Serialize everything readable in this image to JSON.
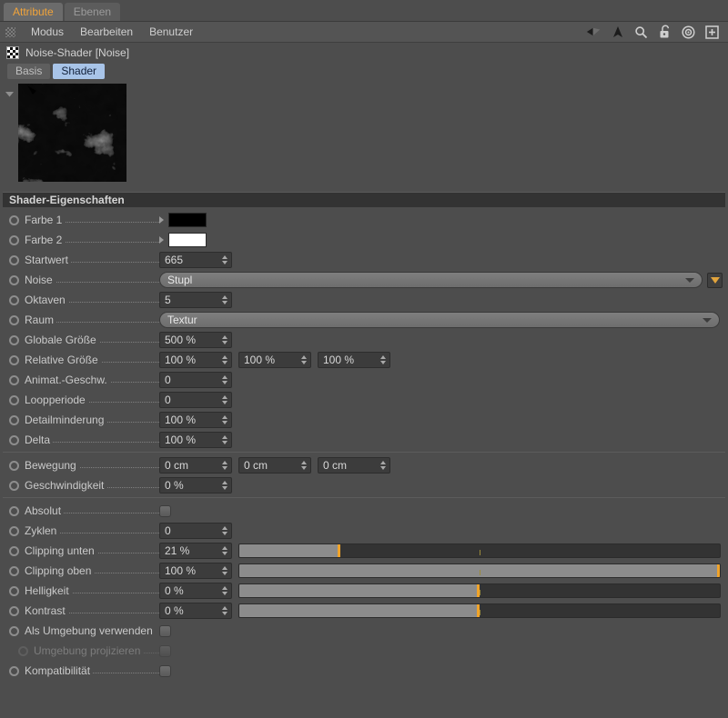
{
  "window": {
    "tabs": [
      {
        "label": "Attribute",
        "active": true
      },
      {
        "label": "Ebenen",
        "active": false
      }
    ]
  },
  "menubar": {
    "grip_icon": "grip-dots-icon",
    "items": [
      "Modus",
      "Bearbeiten",
      "Benutzer"
    ],
    "icons": [
      "back-arrow-icon",
      "up-arrow-icon",
      "search-icon",
      "lock-open-icon",
      "target-icon",
      "plus-box-icon"
    ]
  },
  "object": {
    "icon": "checker-shader-icon",
    "name": "Noise-Shader [Noise]"
  },
  "subtabs": [
    {
      "label": "Basis",
      "active": false
    },
    {
      "label": "Shader",
      "active": true
    }
  ],
  "preview": {
    "collapse_icon": "triangle-down-icon",
    "alt": "noise-preview-thumbnail"
  },
  "group": {
    "title": "Shader-Eigenschaften"
  },
  "rows": [
    {
      "label": "Farbe 1",
      "type": "color",
      "color": "#000000",
      "arrow": true
    },
    {
      "label": "Farbe 2",
      "type": "color",
      "color": "#ffffff",
      "arrow": true
    },
    {
      "label": "Startwert",
      "type": "number",
      "fields": [
        "665"
      ]
    },
    {
      "label": "Noise",
      "type": "combo",
      "value": "Stupl",
      "filter": true
    },
    {
      "label": "Oktaven",
      "type": "number",
      "fields": [
        "5"
      ]
    },
    {
      "label": "Raum",
      "type": "combo",
      "value": "Textur",
      "filter": false
    },
    {
      "label": "Globale Größe",
      "type": "number",
      "fields": [
        "500 %"
      ]
    },
    {
      "label": "Relative Größe",
      "type": "number",
      "fields": [
        "100 %",
        "100 %",
        "100 %"
      ]
    },
    {
      "label": "Animat.-Geschw.",
      "type": "number",
      "fields": [
        "0"
      ]
    },
    {
      "label": "Loopperiode",
      "type": "number",
      "fields": [
        "0"
      ]
    },
    {
      "label": "Detailminderung",
      "type": "number",
      "fields": [
        "100 %"
      ]
    },
    {
      "label": "Delta",
      "type": "number",
      "fields": [
        "100 %"
      ]
    },
    {
      "label": "Bewegung",
      "type": "number",
      "fields": [
        "0 cm",
        "0 cm",
        "0 cm"
      ],
      "separator": true
    },
    {
      "label": "Geschwindigkeit",
      "type": "number",
      "fields": [
        "0 %"
      ]
    },
    {
      "label": "Absolut",
      "type": "check",
      "checked": false,
      "separator": true
    },
    {
      "label": "Zyklen",
      "type": "number",
      "fields": [
        "0"
      ]
    },
    {
      "label": "Clipping unten",
      "type": "slider",
      "fields": [
        "21 %"
      ],
      "fill": 21,
      "tick": 50
    },
    {
      "label": "Clipping oben",
      "type": "slider",
      "fields": [
        "100 %"
      ],
      "fill": 100,
      "tick": 50
    },
    {
      "label": "Helligkeit",
      "type": "slider",
      "fields": [
        "0 %"
      ],
      "fill": 50,
      "tick": 50
    },
    {
      "label": "Kontrast",
      "type": "slider",
      "fields": [
        "0 %"
      ],
      "fill": 50,
      "tick": 50
    },
    {
      "label": "Als Umgebung verwenden",
      "type": "check",
      "checked": false,
      "nodots": true
    },
    {
      "label": "Umgebung projizieren",
      "type": "check",
      "checked": false,
      "disabled": true,
      "indent": true
    },
    {
      "label": "Kompatibilität",
      "type": "check",
      "checked": false
    }
  ],
  "colors": {
    "panel_bg": "#4d4d4d",
    "group_bg": "#333333",
    "field_bg": "#3c3c3c",
    "accent_orange": "#f0a32a",
    "tab_active_text": "#f2a43a",
    "subtab_active_bg": "#a8c4e8",
    "slider_fill": "#8c8c8c"
  }
}
